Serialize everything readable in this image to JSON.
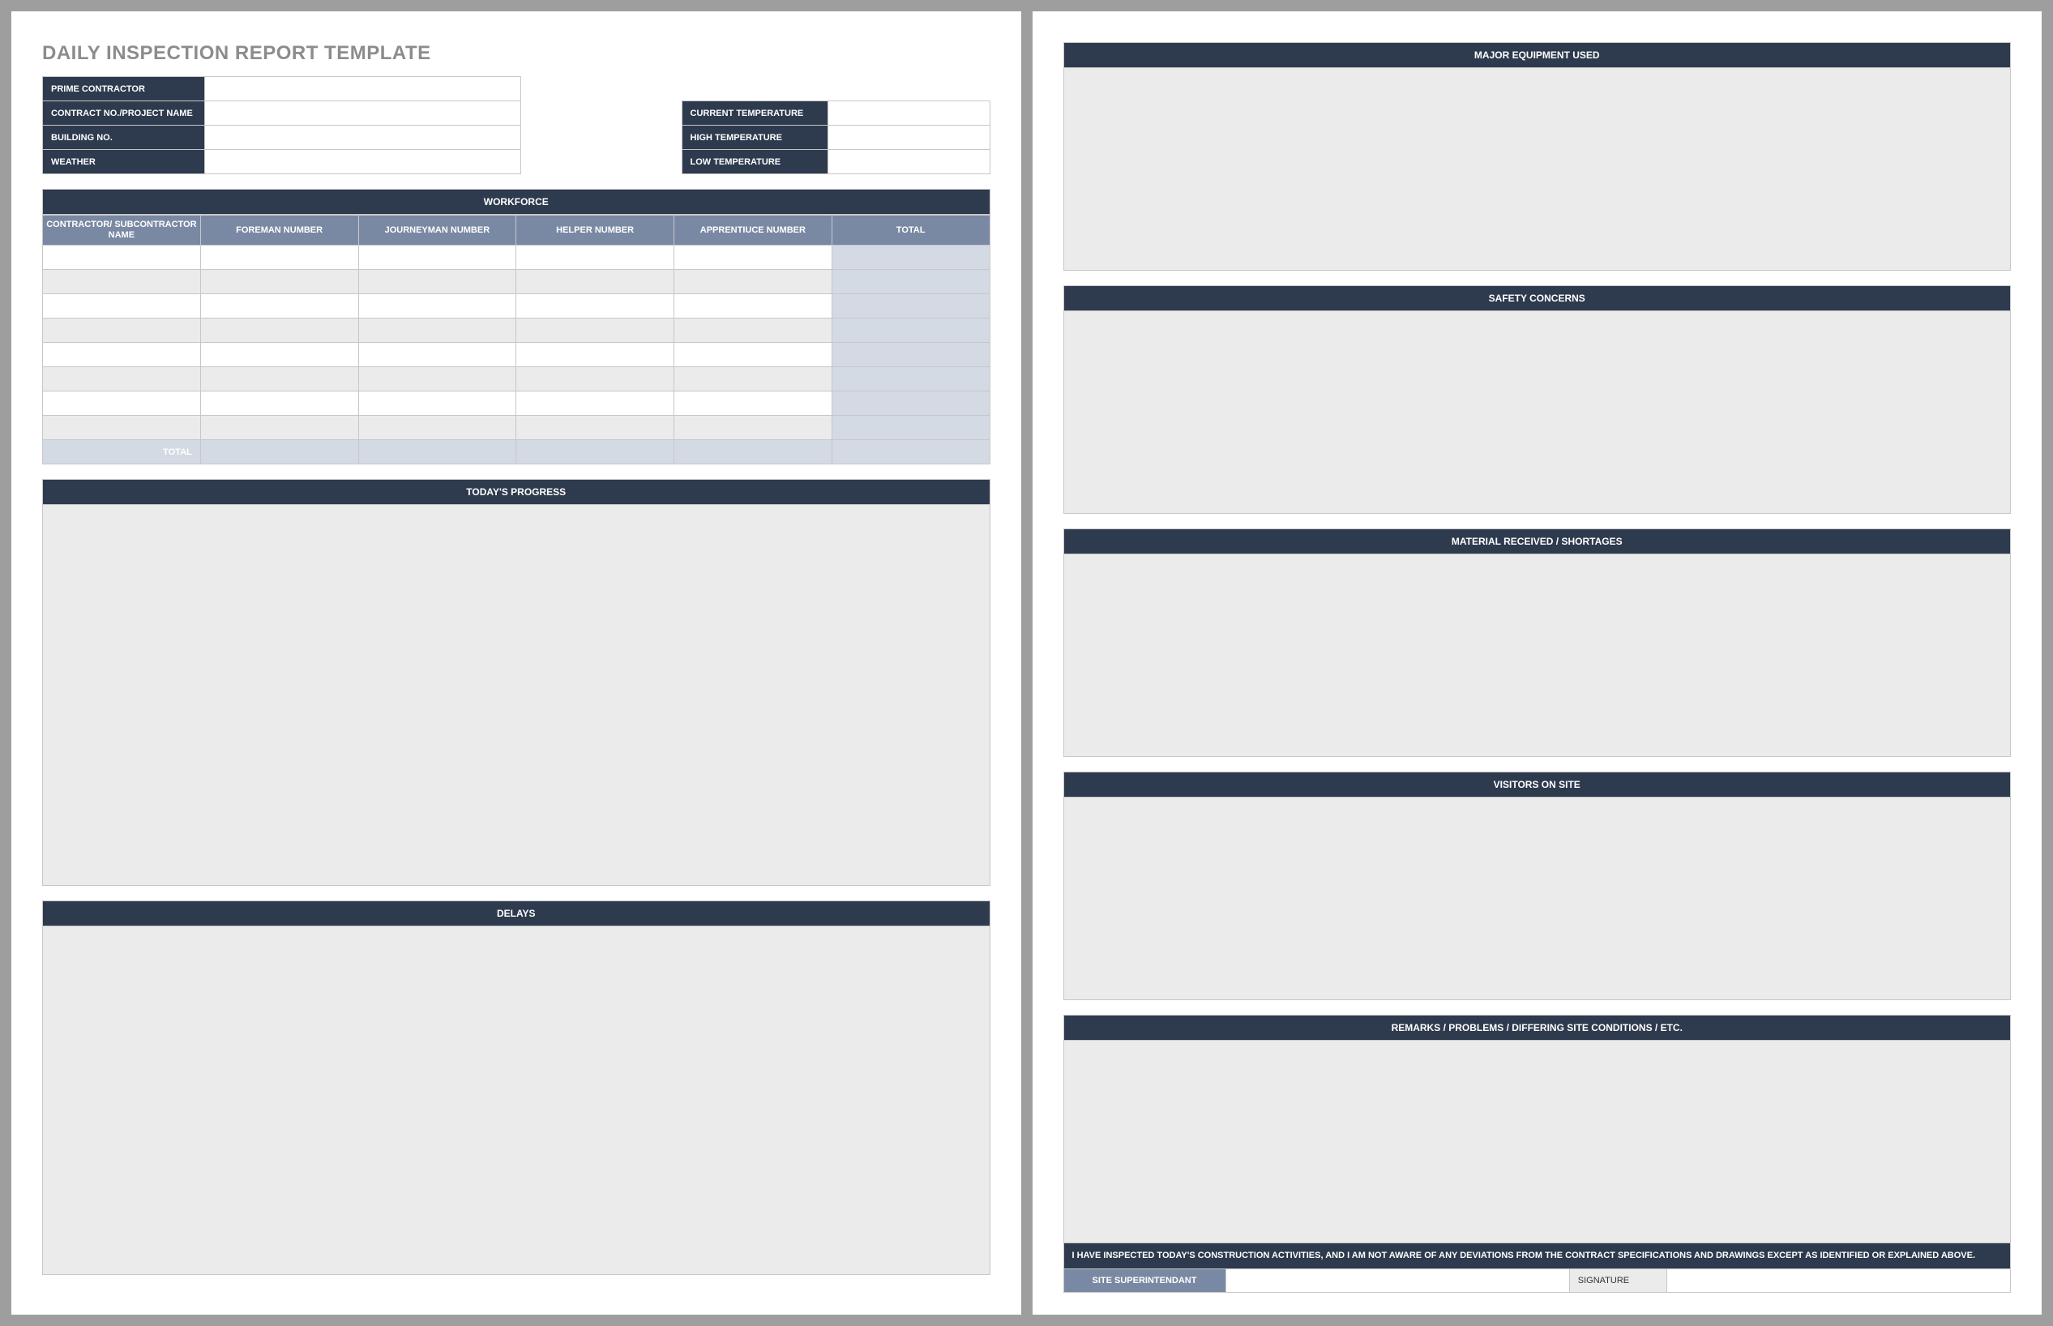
{
  "title": "DAILY INSPECTION REPORT TEMPLATE",
  "header_left": {
    "prime_contractor": "PRIME CONTRACTOR",
    "contract_no": "CONTRACT NO./PROJECT NAME",
    "building_no": "BUILDING NO.",
    "weather": "WEATHER"
  },
  "header_right": {
    "current_temp": "CURRENT TEMPERATURE",
    "high_temp": "HIGH TEMPERATURE",
    "low_temp": "LOW TEMPERATURE"
  },
  "workforce": {
    "title": "WORKFORCE",
    "cols": {
      "c0": "CONTRACTOR/ SUBCONTRACTOR NAME",
      "c1": "FOREMAN NUMBER",
      "c2": "JOURNEYMAN NUMBER",
      "c3": "HELPER NUMBER",
      "c4": "APPRENTIUCE NUMBER",
      "c5": "TOTAL"
    },
    "total_label": "TOTAL"
  },
  "sections": {
    "progress": "TODAY'S PROGRESS",
    "delays": "DELAYS",
    "equipment": "MAJOR EQUIPMENT USED",
    "safety": "SAFETY CONCERNS",
    "material": "MATERIAL RECEIVED / SHORTAGES",
    "visitors": "VISITORS ON SITE",
    "remarks": "REMARKS / PROBLEMS / DIFFERING SITE CONDITIONS / ETC."
  },
  "certification": "I HAVE INSPECTED TODAY'S CONSTRUCTION ACTIVITIES, AND I AM NOT AWARE OF ANY DEVIATIONS FROM THE CONTRACT SPECIFICATIONS AND DRAWINGS EXCEPT AS IDENTIFIED OR EXPLAINED ABOVE.",
  "signature": {
    "label": "SITE SUPERINTENDANT",
    "sig_label": "SIGNATURE"
  }
}
